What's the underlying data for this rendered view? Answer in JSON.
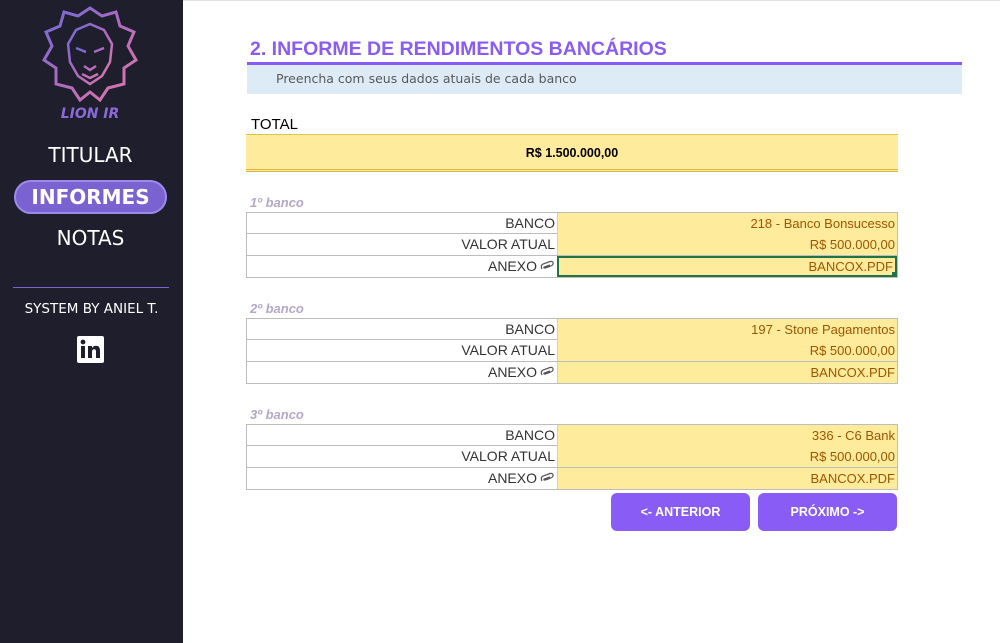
{
  "sidebar": {
    "logo_text": "LION IR",
    "nav": [
      {
        "label": "TITULAR",
        "active": false
      },
      {
        "label": "INFORMES",
        "active": true
      },
      {
        "label": "NOTAS",
        "active": false
      }
    ],
    "system_by": "SYSTEM BY ANIEL T.",
    "social_icon": "linkedin-icon"
  },
  "main": {
    "title": "2. INFORME DE RENDIMENTOS BANCÁRIOS",
    "subtitle": "Preencha com seus dados atuais de cada banco",
    "total_label": "TOTAL",
    "total_value": "R$ 1.500.000,00",
    "banks": [
      {
        "heading": "1º banco",
        "banco": "218 - Banco Bonsucesso",
        "valor": "R$ 500.000,00",
        "anexo": "BANCOX.PDF"
      },
      {
        "heading": "2º banco",
        "banco": "197 - Stone Pagamentos",
        "valor": "R$ 500.000,00",
        "anexo": "BANCOX.PDF"
      },
      {
        "heading": "3º banco",
        "banco": "336 - C6 Bank",
        "valor": "R$ 500.000,00",
        "anexo": "BANCOX.PDF"
      }
    ],
    "field_labels": {
      "banco": "BANCO",
      "valor": "VALOR ATUAL",
      "anexo": "ANEXO"
    },
    "buttons": {
      "previous": "<- ANTERIOR",
      "next": "PRÓXIMO ->"
    }
  },
  "colors": {
    "sidebar_bg": "#1e1e2c",
    "accent": "#8a5cf6",
    "cell_fill": "#ffeb9c",
    "cell_text": "#9c5700",
    "subtitle_bg": "#ddebf7"
  }
}
